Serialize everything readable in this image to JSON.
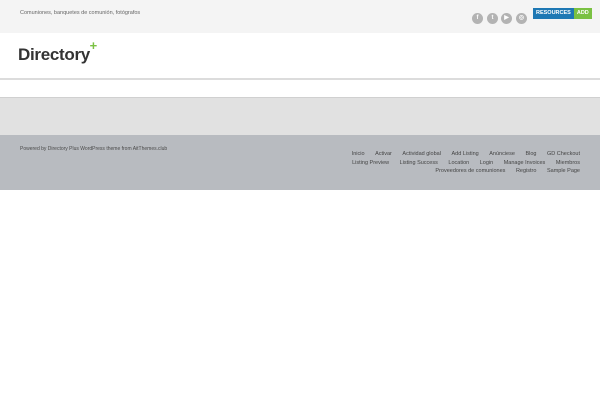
{
  "topbar": {
    "tagline": "Comuniones, banquetes de comunión, fotógrafos",
    "social": [
      {
        "icon": "facebook-icon",
        "glyph": "f"
      },
      {
        "icon": "twitter-icon",
        "glyph": "t"
      },
      {
        "icon": "youtube-icon",
        "glyph": "▶"
      },
      {
        "icon": "instagram-icon",
        "glyph": "◎"
      }
    ],
    "resources_label": "RESOURCES",
    "add_label": "ADD"
  },
  "header": {
    "logo_text": "Directory",
    "logo_plus": "+"
  },
  "footer": {
    "credit": "Powered by Directory Plus WordPress theme from AitThemes.club",
    "menu_row1": [
      "Inicio",
      "Activar",
      "Actividad global",
      "Add Listing",
      "Anúnciese",
      "Blog",
      "GD Checkout"
    ],
    "menu_row2": [
      "Listing Preview",
      "Listing Success",
      "Location",
      "Login",
      "Manage Invoices",
      "Miembros"
    ],
    "menu_row3": [
      "Proveedores de comuniones",
      "Registro",
      "Sample Page"
    ]
  },
  "colors": {
    "accent_blue": "#1e78b4",
    "accent_green": "#7ac142"
  }
}
